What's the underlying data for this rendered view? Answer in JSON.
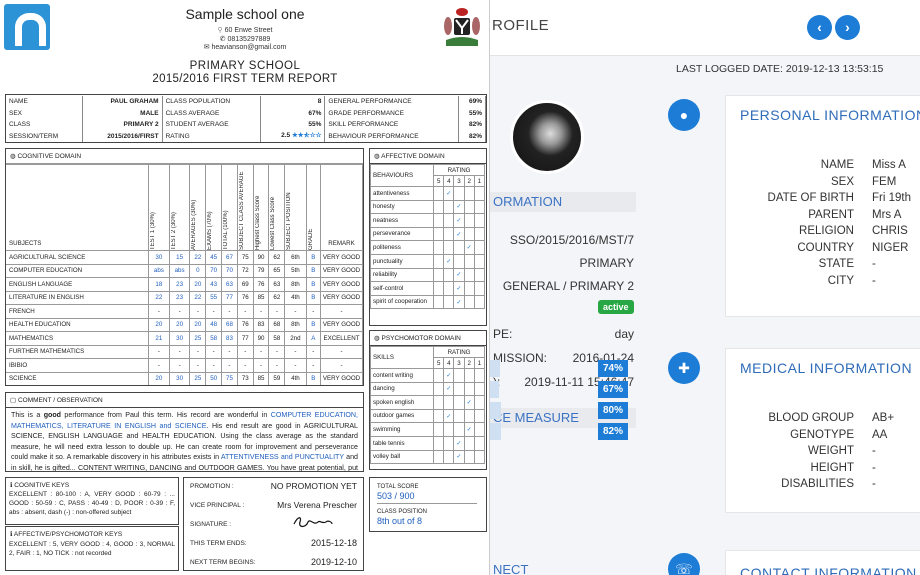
{
  "colors": {
    "accent": "#1c7cd6",
    "link": "#1f5fbf",
    "success": "#28a745"
  },
  "report": {
    "school_name": "Sample school one",
    "address": "60 Enwe Street",
    "phone": "08135297889",
    "email": "heavianson@gmail.com",
    "level": "PRIMARY SCHOOL",
    "term_title": "2015/2016 FIRST TERM REPORT",
    "info": [
      {
        "l1": "NAME",
        "v1": "PAUL GRAHAM",
        "l2": "CLASS POPULATION",
        "v2": "8",
        "l3": "GENERAL PERFORMANCE",
        "v3": "69%"
      },
      {
        "l1": "SEX",
        "v1": "MALE",
        "l2": "CLASS AVERAGE",
        "v2": "67%",
        "l3": "GRADE PERFORMANCE",
        "v3": "55%"
      },
      {
        "l1": "CLASS",
        "v1": "PRIMARY 2",
        "l2": "STUDENT AVERAGE",
        "v2": "55%",
        "l3": "SKILL PERFORMANCE",
        "v3": "82%"
      },
      {
        "l1": "SESSION/TERM",
        "v1": "2015/2016/FIRST",
        "l2": "RATING",
        "v2": "2.5",
        "l3": "BEHAVIOUR PERFORMANCE",
        "v3": "82%"
      }
    ],
    "rating_stars": 2.5,
    "cognitive_title": "COGNITIVE DOMAIN",
    "cognitive_headers": [
      "SUBJECTS",
      "TEST 1 (30%)",
      "TEST 2 (30%)",
      "AVERAGES (30%)",
      "EXAMS (70%)",
      "TOTAL (100%)",
      "SUBJECT CLASS AVERAGE",
      "Highest Class Score",
      "Lowest Class Score",
      "SUBJECT POSITION",
      "GRADE",
      "REMARK"
    ],
    "subjects": [
      [
        "AGRICULTURAL SCIENCE",
        "30",
        "15",
        "22",
        "45",
        "67",
        "75",
        "90",
        "62",
        "6th",
        "B",
        "VERY GOOD"
      ],
      [
        "COMPUTER EDUCATION",
        "abs",
        "abs",
        "0",
        "70",
        "70",
        "72",
        "79",
        "65",
        "5th",
        "B",
        "VERY GOOD"
      ],
      [
        "ENGLISH LANGUAGE",
        "18",
        "23",
        "20",
        "43",
        "63",
        "69",
        "76",
        "63",
        "8th",
        "B",
        "VERY GOOD"
      ],
      [
        "LITERATURE IN ENGLISH",
        "22",
        "23",
        "22",
        "55",
        "77",
        "76",
        "85",
        "62",
        "4th",
        "B",
        "VERY GOOD"
      ],
      [
        "FRENCH",
        "-",
        "-",
        "-",
        "-",
        "-",
        "-",
        "-",
        "-",
        "-",
        "-",
        "-"
      ],
      [
        "HEALTH EDUCATION",
        "20",
        "20",
        "20",
        "48",
        "68",
        "76",
        "83",
        "68",
        "8th",
        "B",
        "VERY GOOD"
      ],
      [
        "MATHEMATICS",
        "21",
        "30",
        "25",
        "58",
        "83",
        "77",
        "90",
        "58",
        "2nd",
        "A",
        "EXCELLENT"
      ],
      [
        "FURTHER MATHEMATICS",
        "-",
        "-",
        "-",
        "-",
        "-",
        "-",
        "-",
        "-",
        "-",
        "-",
        "-"
      ],
      [
        "IBIBIO",
        "-",
        "-",
        "-",
        "-",
        "-",
        "-",
        "-",
        "-",
        "-",
        "-",
        "-"
      ],
      [
        "SCIENCE",
        "20",
        "30",
        "25",
        "50",
        "75",
        "73",
        "85",
        "59",
        "4th",
        "B",
        "VERY GOOD"
      ]
    ],
    "affective_title": "AFFECTIVE DOMAIN",
    "behaviours_label": "BEHAVIOURS",
    "rating_label": "RATING",
    "rating_scale": [
      "5",
      "4",
      "3",
      "2",
      "1"
    ],
    "behaviours": [
      {
        "name": "attentiveness",
        "r": 4
      },
      {
        "name": "honesty",
        "r": 3
      },
      {
        "name": "neatness",
        "r": 3
      },
      {
        "name": "perseverance",
        "r": 3
      },
      {
        "name": "politeness",
        "r": 2
      },
      {
        "name": "punctuality",
        "r": 4
      },
      {
        "name": "reliability",
        "r": 3
      },
      {
        "name": "self-control",
        "r": 3
      },
      {
        "name": "spirit of cooperation",
        "r": 3
      }
    ],
    "psychomotor_title": "PSYCHOMOTOR DOMAIN",
    "skills_label": "SKILLS",
    "skills": [
      {
        "name": "content writing",
        "r": 4
      },
      {
        "name": "dancing",
        "r": 4
      },
      {
        "name": "spoken english",
        "r": 2
      },
      {
        "name": "outdoor games",
        "r": 4
      },
      {
        "name": "swimming",
        "r": 2
      },
      {
        "name": "table tennis",
        "r": 3
      },
      {
        "name": "volley ball",
        "r": 3
      }
    ],
    "comment_title": "COMMENT / OBSERVATION",
    "comment_parts": [
      [
        "t",
        "This is a "
      ],
      [
        "b",
        "good"
      ],
      [
        "t",
        " performance from Paul this term. His record are wonderful in "
      ],
      [
        "l",
        "COMPUTER EDUCATION, MATHEMATICS, LITERATURE IN ENGLISH and SCIENCE"
      ],
      [
        "t",
        ". His end result are good in AGRICULTURAL SCIENCE, ENGLISH LANGUAGE and HEALTH EDUCATION. Using the class average as the standard measure, he will need extra lesson to double up. He can create room for improvement and perseverance could make it so. A remarkable discovery in his attributes exists in "
      ],
      [
        "l",
        "ATTENTIVENESS and PUNCTUALITY"
      ],
      [
        "t",
        " and in skill, he is gifted... CONTENT WRITING, DANCING and OUTDOOR GAMES. You have great potential, put more effort."
      ]
    ],
    "cog_keys_title": "COGNITIVE KEYS",
    "cog_keys_text": "EXCELLENT : 80-100 : A, VERY GOOD : 60-79 : ... GOOD : 50-59 : C, PASS : 40-49 : D, POOR : 0-39 : F, abs : absent, dash (-) : non-offered subject",
    "aff_keys_title": "AFFECTIVE/PSYCHOMOTOR KEYS",
    "aff_keys_text": "EXCELLENT : 5, VERY GOOD : 4, GOOD : 3, NORMAL 2, FAIR : 1, NO TICK : not recorded",
    "promotion_label": "PROMOTION :",
    "promotion_value": "NO PROMOTION YET",
    "vp_label": "VICE PRINCIPAL :",
    "vp_value": "Mrs Verena Prescher",
    "signature_label": "SIGNATURE :",
    "term_ends_label": "THIS TERM ENDS:",
    "term_ends_value": "2015-12-18",
    "next_term_label": "NEXT TERM BEGINS:",
    "next_term_value": "2019-12-10",
    "total_score_label": "TOTAL SCORE",
    "total_score_value": "503 / 900",
    "class_position_label": "CLASS POSITION",
    "class_position_value": "8th out of 8"
  },
  "profile": {
    "title_partial": "ROFILE",
    "last_logged": "LAST LOGGED DATE: 2019-12-13 13:53:15",
    "info_head_partial": "ORMATION",
    "admission_no": "SSO/2015/2016/MST/7",
    "section": "PRIMARY",
    "class_arm": "GENERAL / PRIMARY 2",
    "status": "active",
    "type_label_partial": "PE:",
    "type_value": "day",
    "admission_label_partial": "MISSION:",
    "admission_value": "2016-01-24",
    "created_label_partial": "):",
    "created_value": "2019-11-11 15:46:47",
    "measure_head_partial": "CE MEASURE",
    "measures": [
      {
        "label": "74%",
        "value": 74
      },
      {
        "label": "67%",
        "value": 67
      },
      {
        "label": "80%",
        "value": 80
      },
      {
        "label": "82%",
        "value": 82
      }
    ],
    "connect_partial": "NECT",
    "personal_title": "PERSONAL INFORMATION",
    "personal": [
      [
        "NAME",
        "Miss A"
      ],
      [
        "SEX",
        "FEM"
      ],
      [
        "DATE OF BIRTH",
        "Fri 19th"
      ],
      [
        "PARENT",
        "Mrs A"
      ],
      [
        "RELIGION",
        "CHRIS"
      ],
      [
        "COUNTRY",
        "NIGER"
      ],
      [
        "STATE",
        "-"
      ],
      [
        "CITY",
        "-"
      ]
    ],
    "medical_title": "MEDICAL INFORMATION",
    "medical": [
      [
        "BLOOD GROUP",
        "AB+"
      ],
      [
        "GENOTYPE",
        "AA"
      ],
      [
        "WEIGHT",
        "-"
      ],
      [
        "HEIGHT",
        "-"
      ],
      [
        "DISABILITIES",
        "-"
      ]
    ],
    "contact_title": "CONTACT INFORMATION"
  }
}
